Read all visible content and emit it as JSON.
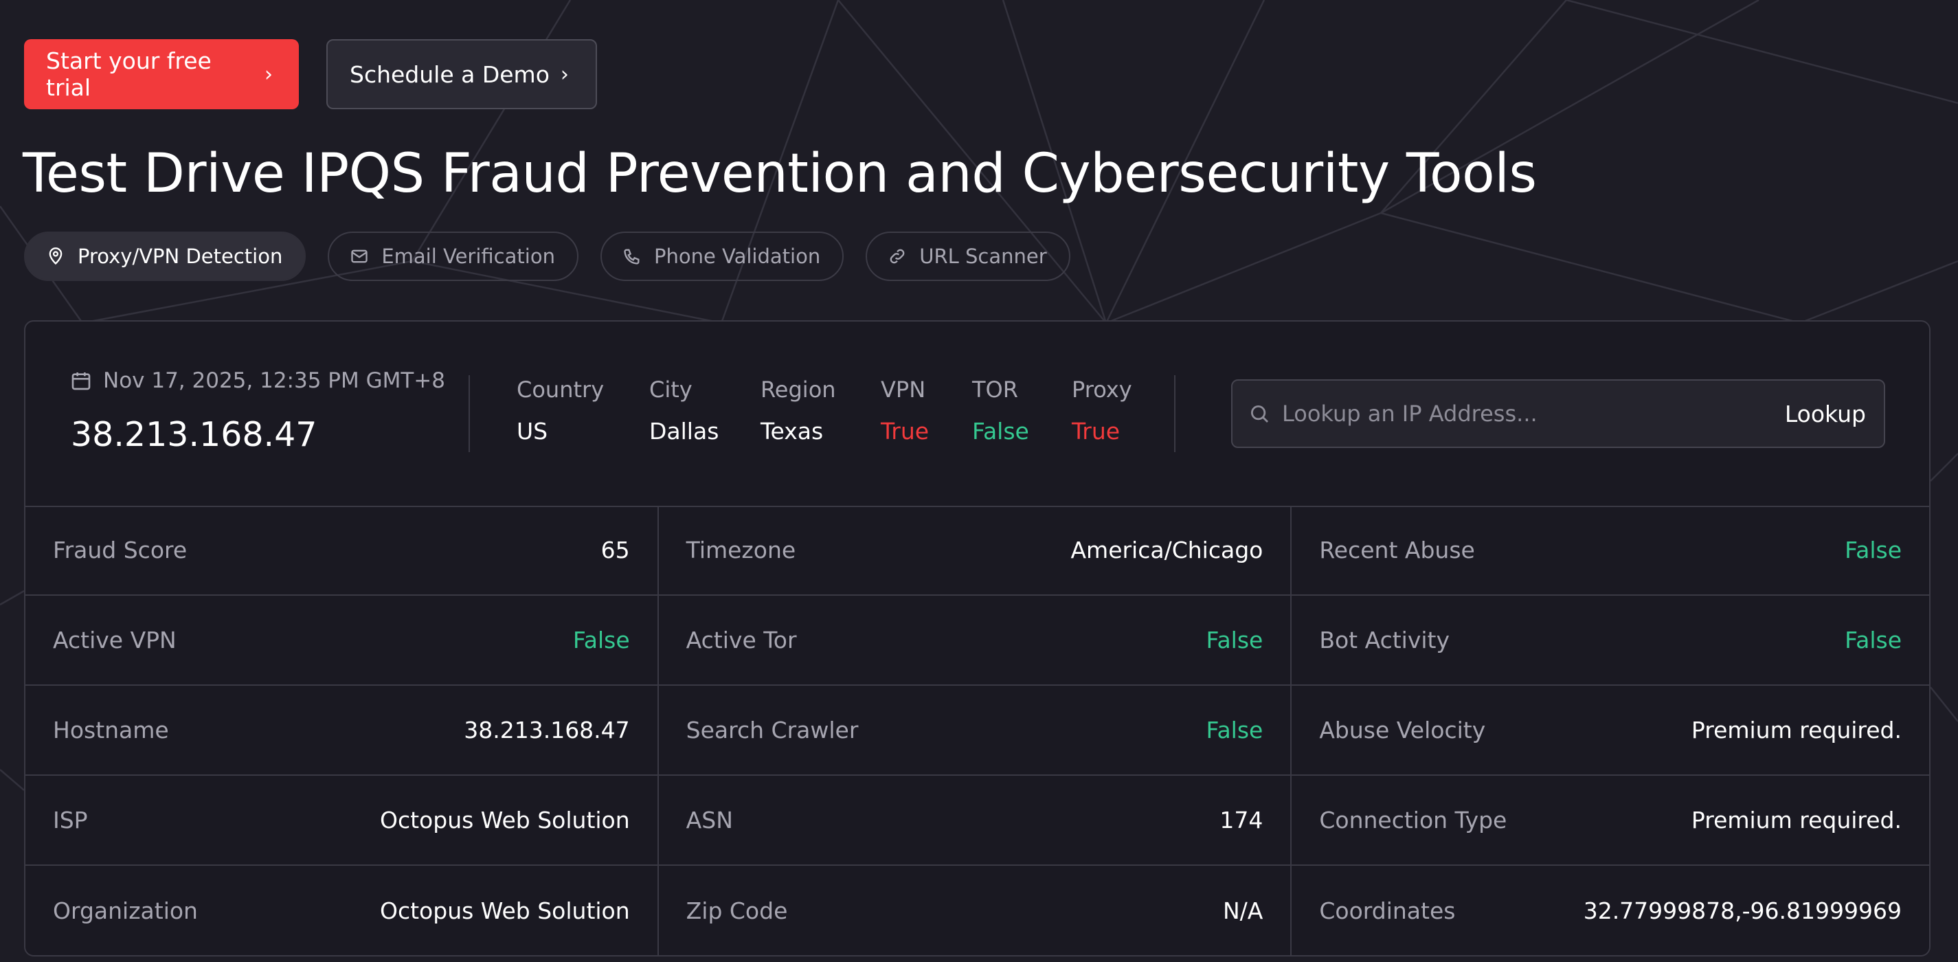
{
  "cta": {
    "primary_label": "Start your free trial",
    "secondary_label": "Schedule a Demo"
  },
  "title": "Test Drive IPQS Fraud Prevention and Cybersecurity Tools",
  "tabs": [
    {
      "label": "Proxy/VPN Detection",
      "icon": "location-pin-icon",
      "active": true
    },
    {
      "label": "Email Verification",
      "icon": "mail-icon",
      "active": false
    },
    {
      "label": "Phone Validation",
      "icon": "phone-icon",
      "active": false
    },
    {
      "label": "URL Scanner",
      "icon": "link-icon",
      "active": false
    }
  ],
  "summary": {
    "timestamp": "Nov 17, 2025, 12:35 PM GMT+8",
    "ip": "38.213.168.47",
    "fields": [
      {
        "label": "Country",
        "value": "US",
        "status": "neutral"
      },
      {
        "label": "City",
        "value": "Dallas",
        "status": "neutral"
      },
      {
        "label": "Region",
        "value": "Texas",
        "status": "neutral"
      },
      {
        "label": "VPN",
        "value": "True",
        "status": "bad"
      },
      {
        "label": "TOR",
        "value": "False",
        "status": "good"
      },
      {
        "label": "Proxy",
        "value": "True",
        "status": "bad"
      }
    ]
  },
  "search": {
    "placeholder": "Lookup an IP Address...",
    "value": "",
    "button_label": "Lookup"
  },
  "details": [
    [
      {
        "key": "Fraud Score",
        "value": "65",
        "status": "neutral"
      },
      {
        "key": "Timezone",
        "value": "America/Chicago",
        "status": "neutral"
      },
      {
        "key": "Recent Abuse",
        "value": "False",
        "status": "good"
      }
    ],
    [
      {
        "key": "Active VPN",
        "value": "False",
        "status": "good"
      },
      {
        "key": "Active Tor",
        "value": "False",
        "status": "good"
      },
      {
        "key": "Bot Activity",
        "value": "False",
        "status": "good"
      }
    ],
    [
      {
        "key": "Hostname",
        "value": "38.213.168.47",
        "status": "neutral"
      },
      {
        "key": "Search Crawler",
        "value": "False",
        "status": "good"
      },
      {
        "key": "Abuse Velocity",
        "value": "Premium required.",
        "status": "neutral"
      }
    ],
    [
      {
        "key": "ISP",
        "value": "Octopus Web Solution",
        "status": "neutral"
      },
      {
        "key": "ASN",
        "value": "174",
        "status": "neutral"
      },
      {
        "key": "Connection Type",
        "value": "Premium required.",
        "status": "neutral"
      }
    ],
    [
      {
        "key": "Organization",
        "value": "Octopus Web Solution",
        "status": "neutral"
      },
      {
        "key": "Zip Code",
        "value": "N/A",
        "status": "neutral"
      },
      {
        "key": "Coordinates",
        "value": "32.77999878,-96.81999969",
        "status": "neutral"
      }
    ]
  ],
  "colors": {
    "accent": "#f23a3c",
    "good": "#35c991",
    "bad": "#f23a3c"
  }
}
